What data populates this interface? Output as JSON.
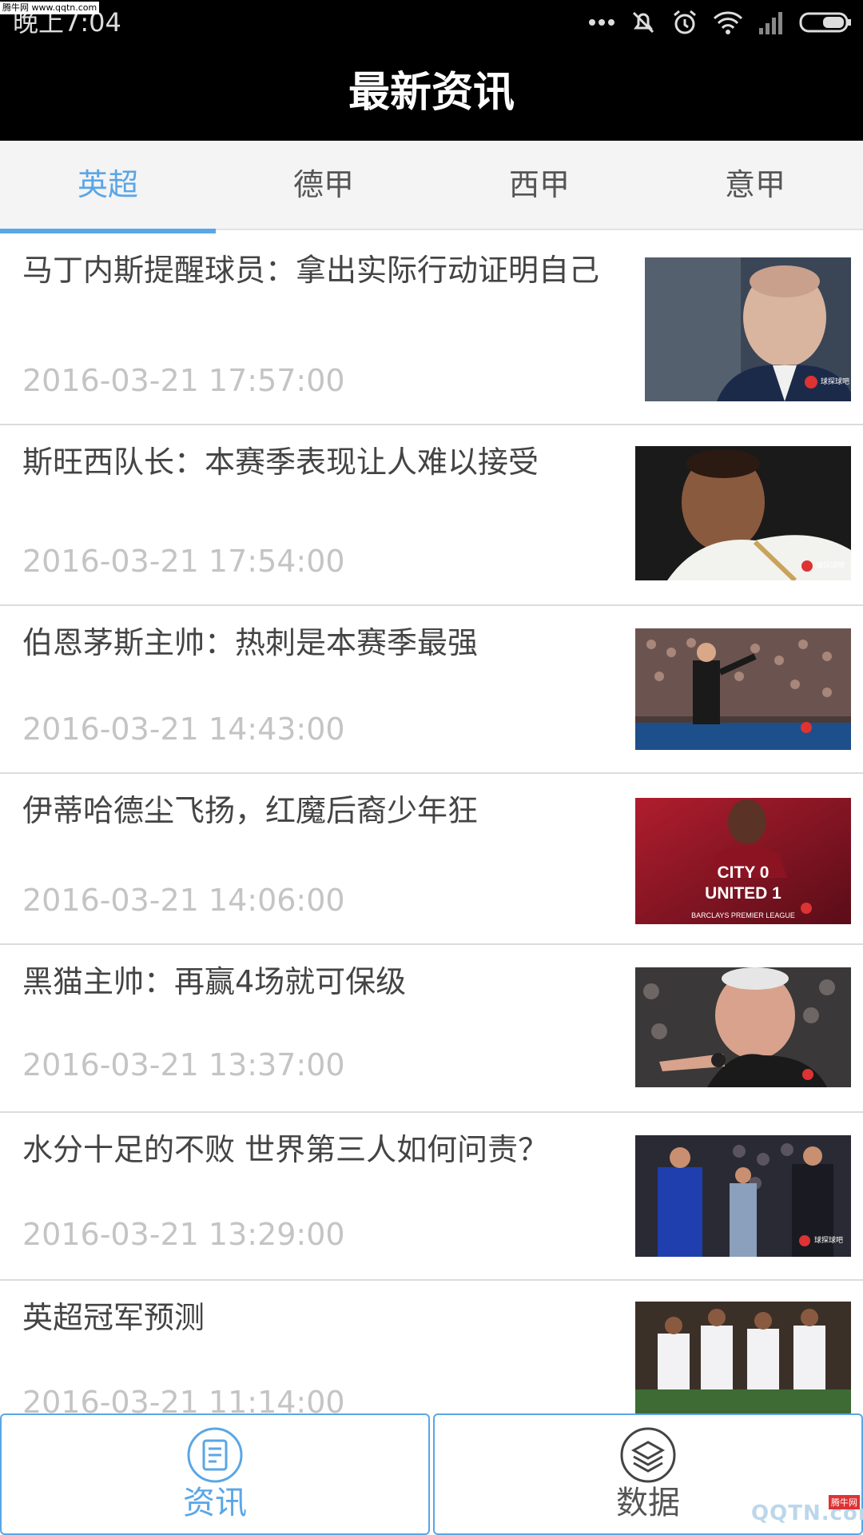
{
  "status_bar": {
    "time": "晚上7:04",
    "watermark": "腾牛网 www.qqtn.com",
    "icons": [
      "more-dots-icon",
      "mute-icon",
      "alarm-icon",
      "wifi-icon",
      "signal-icon",
      "battery-icon"
    ]
  },
  "header": {
    "title": "最新资讯"
  },
  "tabs": [
    {
      "label": "英超",
      "active": true
    },
    {
      "label": "德甲",
      "active": false
    },
    {
      "label": "西甲",
      "active": false
    },
    {
      "label": "意甲",
      "active": false
    }
  ],
  "news": [
    {
      "title": "马丁内斯提醒球员：拿出实际行动证明自己",
      "time": "2016-03-21 17:57:00",
      "image": "coach-portrait-photo"
    },
    {
      "title": "斯旺西队长：本赛季表现让人难以接受",
      "time": "2016-03-21 17:54:00",
      "image": "player-white-kit-photo"
    },
    {
      "title": "伯恩茅斯主帅：热刺是本赛季最强",
      "time": "2016-03-21 14:43:00",
      "image": "manager-touchline-photo"
    },
    {
      "title": "伊蒂哈德尘飞扬，红魔后裔少年狂",
      "time": "2016-03-21 14:06:00",
      "image": "derby-result-photo",
      "image_text": [
        "CITY 0",
        "UNITED 1",
        "BARCLAYS PREMIER LEAGUE"
      ]
    },
    {
      "title": "黑猫主帅：再赢4场就可保级",
      "time": "2016-03-21 13:37:00",
      "image": "manager-pointing-photo"
    },
    {
      "title": "水分十足的不败 世界第三人如何问责？",
      "time": "2016-03-21 13:29:00",
      "image": "blue-kit-players-photo"
    },
    {
      "title": "英超冠军预测",
      "time": "2016-03-21 11:14:00",
      "image": "players-celebrating-photo"
    }
  ],
  "image_watermark": "球探球吧",
  "bottom_nav": [
    {
      "label": "资讯",
      "icon": "news-doc-icon",
      "active": true
    },
    {
      "label": "数据",
      "icon": "layers-icon",
      "active": false
    }
  ],
  "bottom_watermark": {
    "text": "QQTN.com",
    "badge": "腾牛网"
  },
  "colors": {
    "accent": "#5aa6e6",
    "header_bg": "#000000",
    "tab_bg": "#f4f4f4",
    "time_text": "#c4c4c4"
  }
}
